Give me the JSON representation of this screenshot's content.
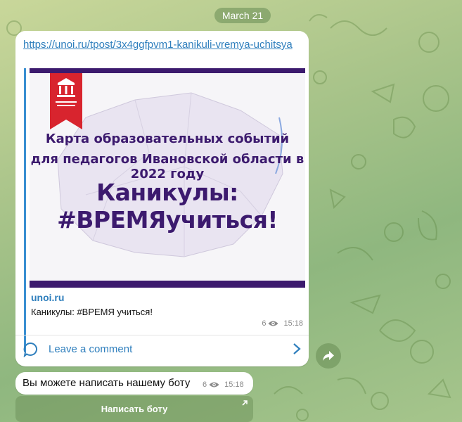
{
  "chat": {
    "date_label": "March 21",
    "messages": [
      {
        "link": "https://unoi.ru/tpost/3x4ggfpvm1-kanikuli-vremya-uchitsya",
        "preview": {
          "banner_line1": "Карта образовательных событий",
          "banner_line2": "для педагогов Ивановской области в 2022 году",
          "banner_line3": "Каникулы: #ВРЕМЯучиться!",
          "site_name": "unoi.ru",
          "description": "Каникулы: #ВРЕМЯ учиться!"
        },
        "views": "6",
        "time": "15:18",
        "comment_label": "Leave a comment"
      },
      {
        "text": "Вы можете написать нашему боту",
        "views": "6",
        "time": "15:18"
      }
    ],
    "bot_button_label": "Написать боту"
  },
  "colors": {
    "link": "#2f7fbd",
    "banner_accent": "#3c1a6e",
    "flag_red": "#d8242e"
  },
  "icons": [
    "views-eye-icon",
    "comment-bubble-icon",
    "chevron-right-icon",
    "share-arrow-icon",
    "external-link-arrow-icon"
  ]
}
